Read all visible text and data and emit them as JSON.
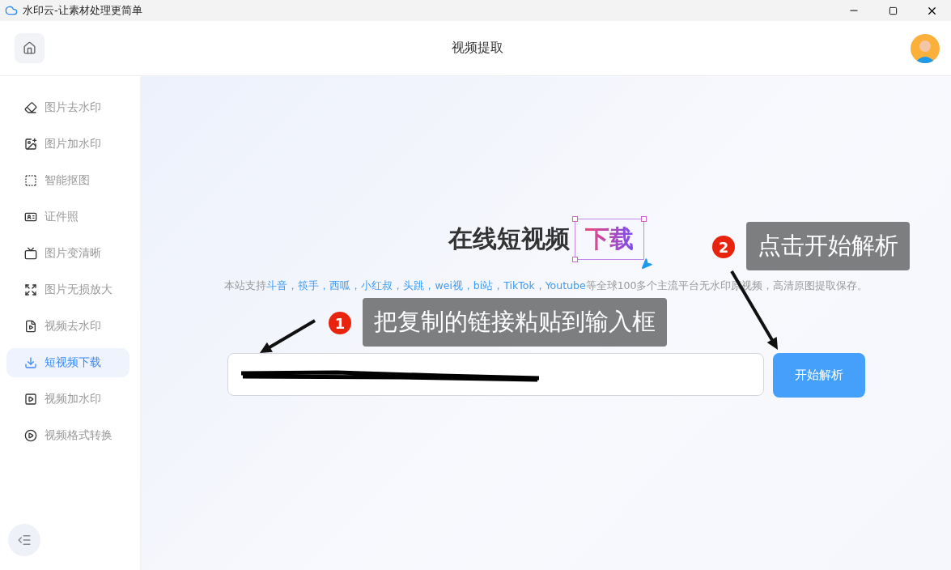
{
  "window": {
    "title": "水印云-让素材处理更简单"
  },
  "header": {
    "title": "视频提取"
  },
  "sidebar": {
    "items": [
      {
        "label": "图片去水印",
        "selected": false
      },
      {
        "label": "图片加水印",
        "selected": false
      },
      {
        "label": "智能抠图",
        "selected": false
      },
      {
        "label": "证件照",
        "selected": false
      },
      {
        "label": "图片变清晰",
        "selected": false
      },
      {
        "label": "图片无损放大",
        "selected": false
      },
      {
        "label": "视频去水印",
        "selected": false
      },
      {
        "label": "短视频下载",
        "selected": true
      },
      {
        "label": "视频加水印",
        "selected": false
      },
      {
        "label": "视频格式转换",
        "selected": false
      }
    ]
  },
  "hero": {
    "title": "在线短视频",
    "highlight": "下载",
    "description": [
      {
        "text": "本站支持",
        "highlight": false
      },
      {
        "text": "斗音，筷手，西呱，小红叔，头跳，wei视，bi站，TikTok，Youtube",
        "highlight": true
      },
      {
        "text": "等全球100多个主流平台无水印原视频，高清原图提取保存。",
        "highlight": false
      }
    ]
  },
  "form": {
    "button": "开始解析"
  },
  "callouts": [
    {
      "number": "1",
      "text": "把复制的链接粘贴到输入框"
    },
    {
      "number": "2",
      "text": "点击开始解析"
    }
  ]
}
